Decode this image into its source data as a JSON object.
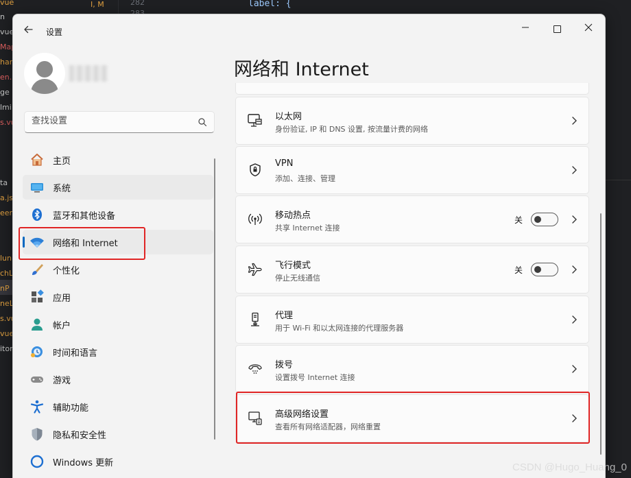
{
  "editor": {
    "files": [
      "vue",
      "n",
      "vue",
      "Map",
      "hart",
      "en.",
      "ge",
      "lmi",
      "s.vu",
      "ta",
      "a.js",
      "eer",
      "lun",
      "chLi",
      "nP",
      "neL",
      "s.vu",
      "vue",
      "itor"
    ],
    "status": "I, M",
    "line_numbers": [
      "282",
      "283"
    ],
    "code": "label: {"
  },
  "window": {
    "title": "设置",
    "back_icon": "back-arrow-icon",
    "minimize_icon": "minimize-icon",
    "maximize_icon": "maximize-icon",
    "close_icon": "close-icon"
  },
  "search": {
    "placeholder": "查找设置"
  },
  "nav": {
    "items": [
      {
        "label": "主页",
        "icon": "home-icon"
      },
      {
        "label": "系统",
        "icon": "system-icon"
      },
      {
        "label": "蓝牙和其他设备",
        "icon": "bluetooth-icon"
      },
      {
        "label": "网络和 Internet",
        "icon": "wifi-icon",
        "selected": true
      },
      {
        "label": "个性化",
        "icon": "brush-icon"
      },
      {
        "label": "应用",
        "icon": "apps-icon"
      },
      {
        "label": "帐户",
        "icon": "account-icon"
      },
      {
        "label": "时间和语言",
        "icon": "time-language-icon"
      },
      {
        "label": "游戏",
        "icon": "gamepad-icon"
      },
      {
        "label": "辅助功能",
        "icon": "accessibility-icon"
      },
      {
        "label": "隐私和安全性",
        "icon": "shield-icon"
      },
      {
        "label": "Windows 更新",
        "icon": "windows-update-icon"
      }
    ]
  },
  "main": {
    "title": "网络和 Internet",
    "cards": [
      {
        "title": "以太网",
        "subtitle": "身份验证, IP 和 DNS 设置, 按流量计费的网络",
        "icon": "ethernet-icon"
      },
      {
        "title": "VPN",
        "subtitle": "添加、连接、管理",
        "icon": "vpn-shield-icon"
      },
      {
        "title": "移动热点",
        "subtitle": "共享 Internet 连接",
        "icon": "hotspot-icon",
        "toggle_label": "关",
        "toggle_on": false
      },
      {
        "title": "飞行模式",
        "subtitle": "停止无线通信",
        "icon": "airplane-icon",
        "toggle_label": "关",
        "toggle_on": false
      },
      {
        "title": "代理",
        "subtitle": "用于 Wi-Fi 和以太网连接的代理服务器",
        "icon": "proxy-icon"
      },
      {
        "title": "拨号",
        "subtitle": "设置拨号 Internet 连接",
        "icon": "dialup-icon"
      },
      {
        "title": "高级网络设置",
        "subtitle": "查看所有网络适配器，网络重置",
        "icon": "advanced-network-icon"
      }
    ]
  },
  "watermark": "CSDN @Hugo_Huang_0",
  "colors": {
    "accent": "#0067c0",
    "annotation": "#e02424",
    "window_bg": "#f3f3f3",
    "card_bg": "#fbfbfb"
  }
}
